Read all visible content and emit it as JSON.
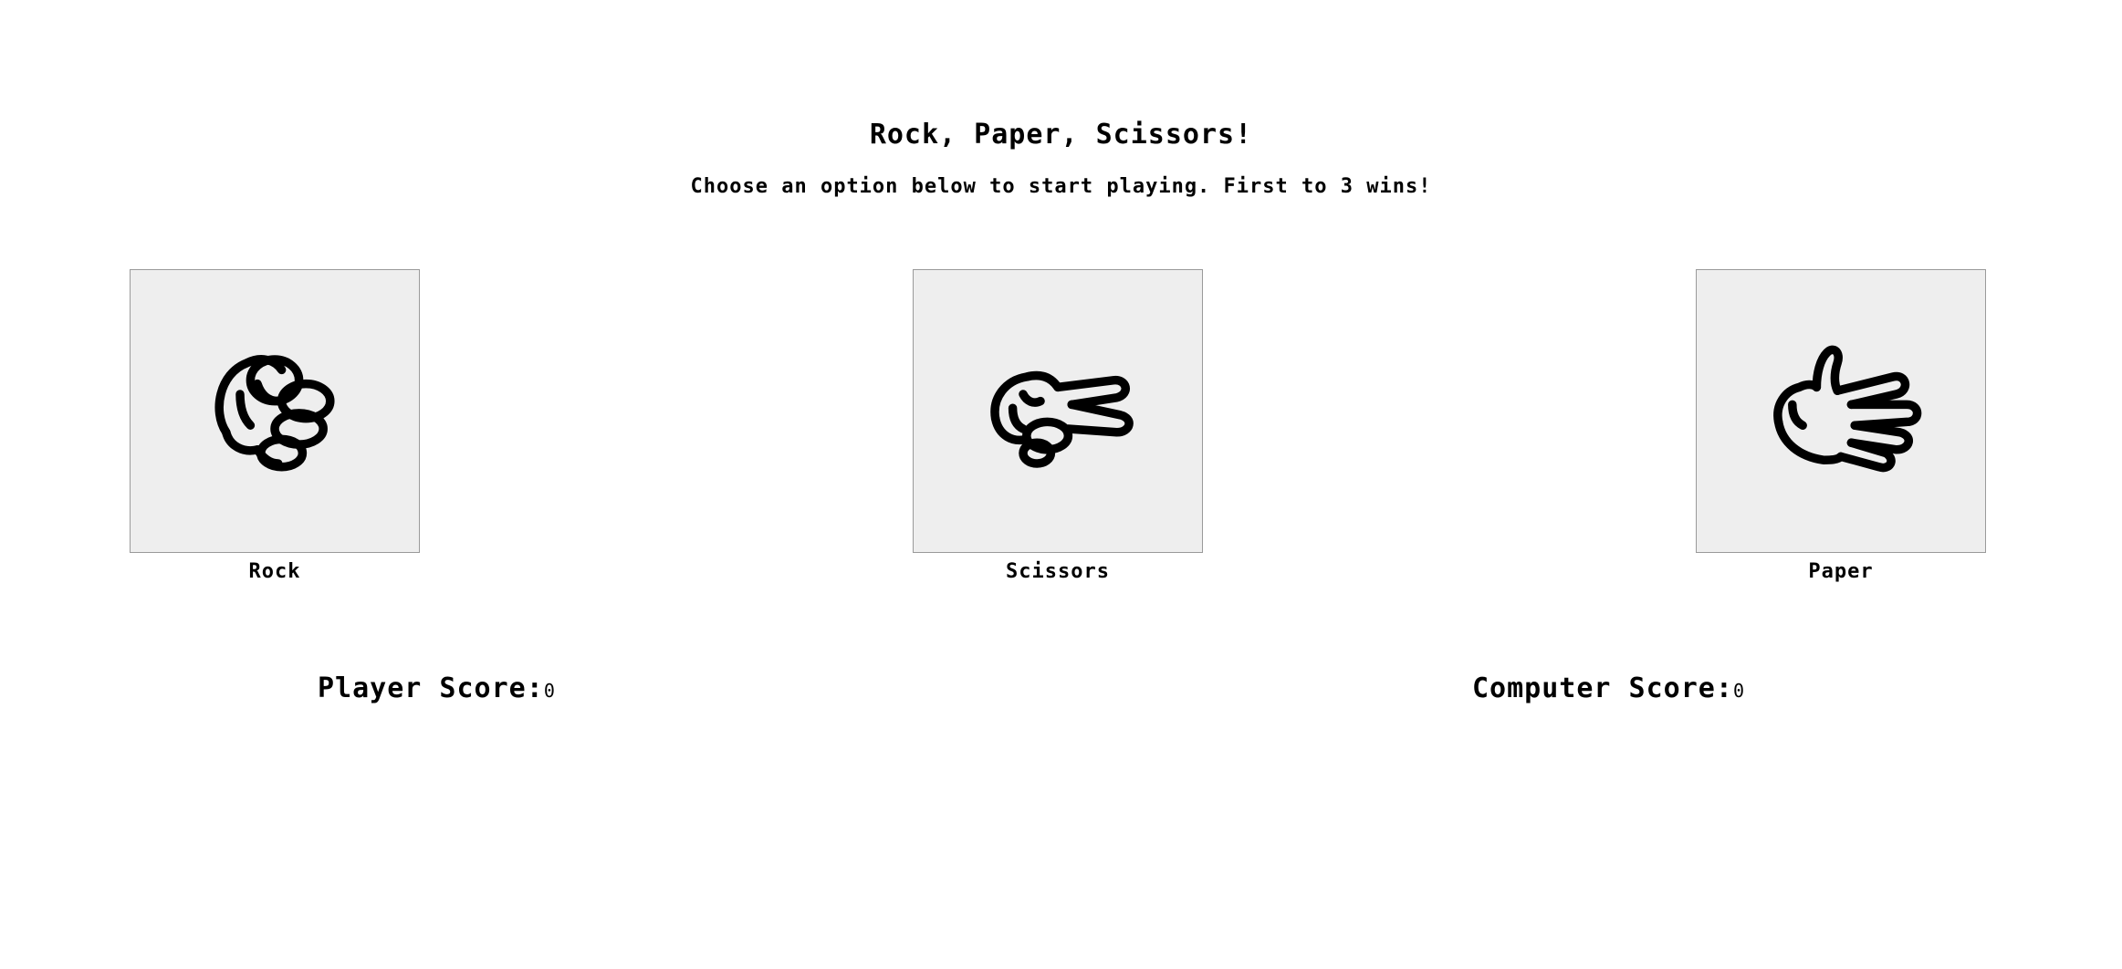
{
  "header": {
    "title": "Rock, Paper, Scissors!",
    "subtitle": "Choose an option below to start playing. First to 3 wins!"
  },
  "choices": [
    {
      "label": "Rock",
      "icon": "rock-hand-icon"
    },
    {
      "label": "Scissors",
      "icon": "scissors-hand-icon"
    },
    {
      "label": "Paper",
      "icon": "paper-hand-icon"
    }
  ],
  "scores": {
    "player_label": "Player Score:",
    "player_value": "0",
    "computer_label": "Computer Score:",
    "computer_value": "0"
  },
  "colors": {
    "card_background": "#eeeeee",
    "card_border": "#9a9a9a",
    "text": "#000000"
  }
}
